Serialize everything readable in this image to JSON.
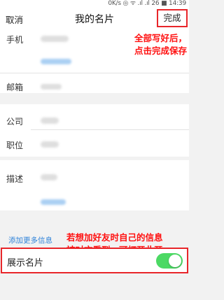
{
  "status_bar": {
    "text": "0K/s ◎ ᯤ .ıl .ıl 26 ■ 14:39"
  },
  "nav": {
    "cancel": "取消",
    "title": "我的名片",
    "done": "完成"
  },
  "fields": {
    "phone": "手机",
    "email": "邮箱",
    "company": "公司",
    "position": "职位",
    "description": "描述"
  },
  "annotations": {
    "done_note": [
      "全部写好后，",
      "点击完成保存"
    ],
    "toggle_note": [
      "若想加好友时自己的信息",
      "被对方看到，可打开此开"
    ]
  },
  "add_more": "添加更多信息",
  "show_card": {
    "label": "展示名片",
    "enabled": true
  },
  "colors": {
    "annotation_red": "#ff1010",
    "link_blue": "#2f83d9",
    "toggle_green": "#4cd964"
  }
}
